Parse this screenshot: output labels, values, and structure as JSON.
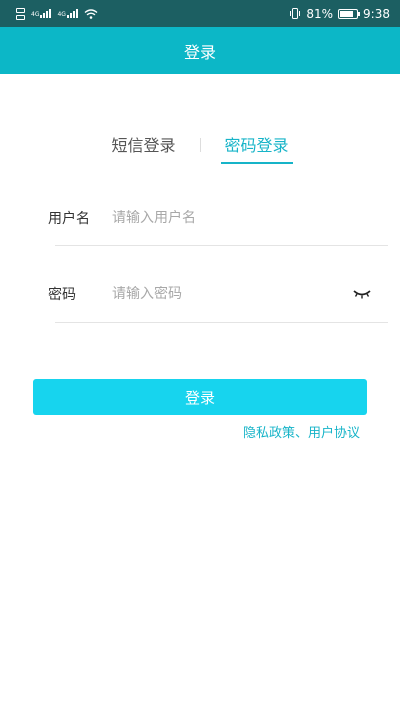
{
  "status_bar": {
    "sim1_signal": "4G",
    "sim2_signal": "4G",
    "battery_percent": "81%",
    "time": "9:38",
    "battery_level": 0.81
  },
  "app_bar": {
    "title": "登录"
  },
  "tabs": [
    {
      "label": "短信登录",
      "active": false
    },
    {
      "label": "密码登录",
      "active": true
    }
  ],
  "form": {
    "username_label": "用户名",
    "username_placeholder": "请输入用户名",
    "username_value": "",
    "password_label": "密码",
    "password_placeholder": "请输入密码",
    "password_value": ""
  },
  "login_button_label": "登录",
  "policy_link": "隐私政策、用户协议",
  "colors": {
    "status_bar": "#1c5f62",
    "app_bar": "#0cb7c7",
    "accent": "#17b4c8",
    "button": "#17d4ee"
  }
}
